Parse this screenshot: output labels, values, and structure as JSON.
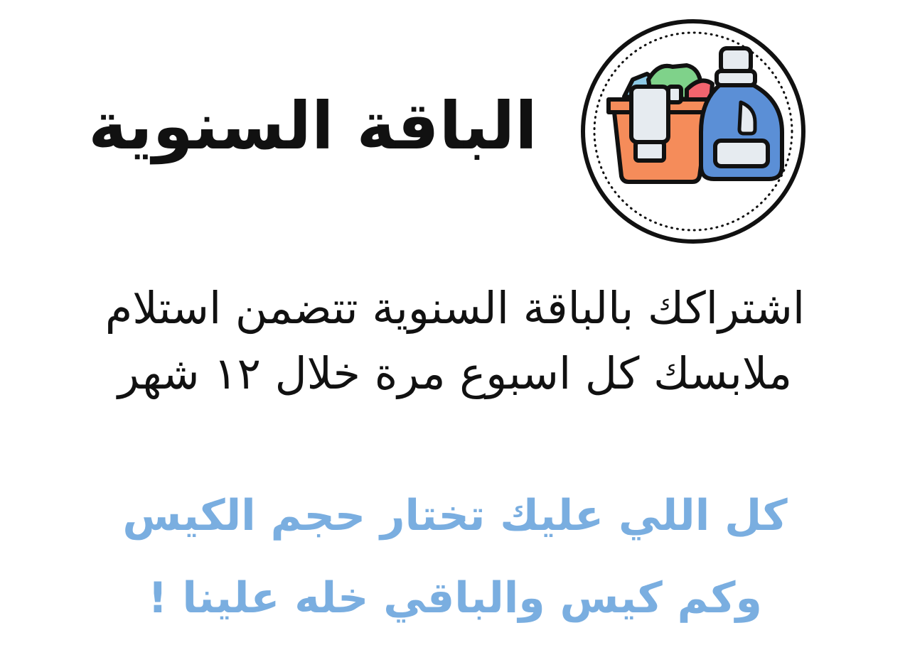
{
  "heading": {
    "title": "الباقة السنوية"
  },
  "description": {
    "line1": "اشتراكك بالباقة السنوية تتضمن استلام",
    "line2": "ملابسك كل اسبوع مرة خلال ١٢ شهر"
  },
  "note": {
    "line1": "كل اللي عليك تختار حجم الكيس",
    "line2": "وكم كيس والباقي خله علينا !"
  },
  "logo": {
    "icon": "laundry-basket-detergent-icon"
  },
  "colors": {
    "text": "#111111",
    "accent": "#7aaee0",
    "basket": "#f58c5a",
    "bottle": "#5b8fd6",
    "cloth_blue": "#8ecae6",
    "cloth_green": "#7fd28a",
    "cloth_red": "#f2646e",
    "cloth_white": "#e6ebf0"
  }
}
